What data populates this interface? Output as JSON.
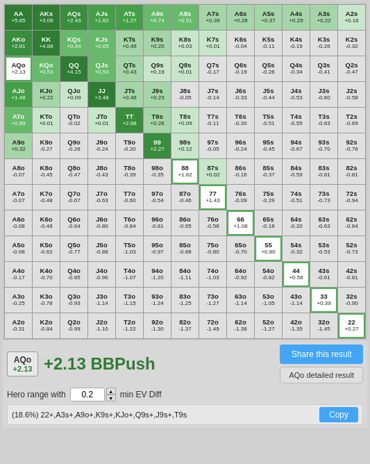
{
  "grid": {
    "cells": [
      {
        "hand": "AA",
        "ev": "+5.85",
        "type": "positive-high"
      },
      {
        "hand": "AKs",
        "ev": "+3.06",
        "type": "positive-high"
      },
      {
        "hand": "AQs",
        "ev": "+2.43",
        "type": "positive-high"
      },
      {
        "hand": "AJs",
        "ev": "+1.82",
        "type": "positive-mid"
      },
      {
        "hand": "ATs",
        "ev": "+1.27",
        "type": "positive-mid"
      },
      {
        "hand": "A9s",
        "ev": "+0.74",
        "type": "positive-low"
      },
      {
        "hand": "A8s",
        "ev": "+0.51",
        "type": "positive-low"
      },
      {
        "hand": "A7s",
        "ev": "+0.39",
        "type": "positive-low"
      },
      {
        "hand": "A6s",
        "ev": "+0.28",
        "type": "positive-low"
      },
      {
        "hand": "A5s",
        "ev": "+0.37",
        "type": "positive-low"
      },
      {
        "hand": "A4s",
        "ev": "+0.29",
        "type": "positive-low"
      },
      {
        "hand": "A3s",
        "ev": "+0.22",
        "type": "positive-low"
      },
      {
        "hand": "A2s",
        "ev": "+0.16",
        "type": "neutral"
      },
      {
        "hand": "AKo",
        "ev": "+2.81",
        "type": "positive-high"
      },
      {
        "hand": "KK",
        "ev": "+4.88",
        "type": "positive-high"
      },
      {
        "hand": "KQs",
        "ev": "+0.94",
        "type": "positive-low"
      },
      {
        "hand": "KJs",
        "ev": "+0.65",
        "type": "positive-low"
      },
      {
        "hand": "KTs",
        "ev": "+0.46",
        "type": "positive-low"
      },
      {
        "hand": "K9s",
        "ev": "+0.20",
        "type": "positive-low"
      },
      {
        "hand": "K8s",
        "ev": "+0.03",
        "type": "neutral"
      },
      {
        "hand": "K7s",
        "ev": "+0.01",
        "type": "neutral"
      },
      {
        "hand": "K6s",
        "ev": "-0.04",
        "type": "neutral"
      },
      {
        "hand": "K5s",
        "ev": "-0.11",
        "type": "neutral"
      },
      {
        "hand": "K4s",
        "ev": "-0.19",
        "type": "neutral"
      },
      {
        "hand": "K3s",
        "ev": "-0.26",
        "type": "neutral"
      },
      {
        "hand": "K2s",
        "ev": "-0.32",
        "type": "neutral"
      },
      {
        "hand": "AQo",
        "ev": "+2.13",
        "type": "positive-high",
        "selected": true
      },
      {
        "hand": "KQo",
        "ev": "+0.53",
        "type": "positive-low"
      },
      {
        "hand": "QQ",
        "ev": "+4.15",
        "type": "positive-high"
      },
      {
        "hand": "QJs",
        "ev": "+0.53",
        "type": "positive-low"
      },
      {
        "hand": "QTs",
        "ev": "+0.43",
        "type": "positive-low"
      },
      {
        "hand": "Q9s",
        "ev": "+0.19",
        "type": "positive-low"
      },
      {
        "hand": "Q8s",
        "ev": "+0.01",
        "type": "neutral"
      },
      {
        "hand": "Q7s",
        "ev": "-0.17",
        "type": "neutral"
      },
      {
        "hand": "Q6s",
        "ev": "-0.19",
        "type": "neutral"
      },
      {
        "hand": "Q5s",
        "ev": "-0.26",
        "type": "neutral"
      },
      {
        "hand": "Q4s",
        "ev": "-0.34",
        "type": "neutral"
      },
      {
        "hand": "Q3s",
        "ev": "-0.41",
        "type": "neutral"
      },
      {
        "hand": "Q2s",
        "ev": "-0.47",
        "type": "neutral"
      },
      {
        "hand": "AJo",
        "ev": "+1.48",
        "type": "positive-mid"
      },
      {
        "hand": "KJo",
        "ev": "+0.22",
        "type": "positive-low"
      },
      {
        "hand": "QJo",
        "ev": "+0.09",
        "type": "neutral"
      },
      {
        "hand": "JJ",
        "ev": "+3.48",
        "type": "positive-high"
      },
      {
        "hand": "JTs",
        "ev": "+0.46",
        "type": "positive-low"
      },
      {
        "hand": "J9s",
        "ev": "+0.23",
        "type": "positive-low"
      },
      {
        "hand": "J8s",
        "ev": "-0.05",
        "type": "neutral"
      },
      {
        "hand": "J7s",
        "ev": "-0.14",
        "type": "neutral"
      },
      {
        "hand": "J6s",
        "ev": "-0.33",
        "type": "neutral"
      },
      {
        "hand": "J5s",
        "ev": "-0.44",
        "type": "neutral"
      },
      {
        "hand": "J4s",
        "ev": "-0.53",
        "type": "neutral"
      },
      {
        "hand": "J3s",
        "ev": "-0.60",
        "type": "neutral"
      },
      {
        "hand": "J2s",
        "ev": "-0.58",
        "type": "neutral"
      },
      {
        "hand": "ATo",
        "ev": "+0.89",
        "type": "positive-low"
      },
      {
        "hand": "KTo",
        "ev": "+0.01",
        "type": "neutral"
      },
      {
        "hand": "QTo",
        "ev": "-0.02",
        "type": "neutral"
      },
      {
        "hand": "JTo",
        "ev": "+0.01",
        "type": "neutral"
      },
      {
        "hand": "TT",
        "ev": "+2.88",
        "type": "positive-high"
      },
      {
        "hand": "T9s",
        "ev": "+0.26",
        "type": "positive-low"
      },
      {
        "hand": "T8s",
        "ev": "+0.09",
        "type": "neutral"
      },
      {
        "hand": "T7s",
        "ev": "-0.11",
        "type": "neutral"
      },
      {
        "hand": "T6s",
        "ev": "-0.30",
        "type": "neutral"
      },
      {
        "hand": "T5s",
        "ev": "-0.51",
        "type": "neutral"
      },
      {
        "hand": "T4s",
        "ev": "-0.55",
        "type": "neutral"
      },
      {
        "hand": "T3s",
        "ev": "-0.63",
        "type": "neutral"
      },
      {
        "hand": "T2s",
        "ev": "-0.69",
        "type": "neutral"
      },
      {
        "hand": "A9o",
        "ev": "+0.32",
        "type": "positive-low"
      },
      {
        "hand": "K9o",
        "ev": "-0.27",
        "type": "neutral"
      },
      {
        "hand": "Q9o",
        "ev": "-0.28",
        "type": "neutral"
      },
      {
        "hand": "J9o",
        "ev": "-0.24",
        "type": "neutral"
      },
      {
        "hand": "T9o",
        "ev": "-0.20",
        "type": "neutral"
      },
      {
        "hand": "99",
        "ev": "+2.27",
        "type": "positive-high"
      },
      {
        "hand": "98s",
        "ev": "+0.12",
        "type": "neutral"
      },
      {
        "hand": "97s",
        "ev": "-0.05",
        "type": "neutral"
      },
      {
        "hand": "96s",
        "ev": "-0.24",
        "type": "neutral"
      },
      {
        "hand": "95s",
        "ev": "-0.45",
        "type": "neutral"
      },
      {
        "hand": "94s",
        "ev": "-0.67",
        "type": "neutral"
      },
      {
        "hand": "93s",
        "ev": "-0.70",
        "type": "neutral"
      },
      {
        "hand": "92s",
        "ev": "-0.76",
        "type": "neutral"
      },
      {
        "hand": "A8o",
        "ev": "-0.07",
        "type": "neutral"
      },
      {
        "hand": "K8o",
        "ev": "-0.45",
        "type": "neutral"
      },
      {
        "hand": "Q8o",
        "ev": "-0.47",
        "type": "neutral"
      },
      {
        "hand": "J8o",
        "ev": "-0.43",
        "type": "neutral"
      },
      {
        "hand": "T8o",
        "ev": "-0.39",
        "type": "neutral"
      },
      {
        "hand": "98o",
        "ev": "-0.35",
        "type": "neutral"
      },
      {
        "hand": "88",
        "ev": "+1.82",
        "type": "positive-mid",
        "selected": true
      },
      {
        "hand": "87s",
        "ev": "+0.02",
        "type": "neutral"
      },
      {
        "hand": "86s",
        "ev": "-0.16",
        "type": "neutral"
      },
      {
        "hand": "85s",
        "ev": "-0.37",
        "type": "neutral"
      },
      {
        "hand": "84s",
        "ev": "-0.59",
        "type": "neutral"
      },
      {
        "hand": "83s",
        "ev": "-0.81",
        "type": "neutral"
      },
      {
        "hand": "82s",
        "ev": "-0.81",
        "type": "neutral"
      },
      {
        "hand": "A7o",
        "ev": "-0.07",
        "type": "neutral"
      },
      {
        "hand": "K7o",
        "ev": "-0.48",
        "type": "neutral"
      },
      {
        "hand": "Q7o",
        "ev": "-0.67",
        "type": "neutral"
      },
      {
        "hand": "J7o",
        "ev": "-0.63",
        "type": "neutral"
      },
      {
        "hand": "T7o",
        "ev": "-0.60",
        "type": "neutral"
      },
      {
        "hand": "97o",
        "ev": "-0.54",
        "type": "neutral"
      },
      {
        "hand": "87o",
        "ev": "-0.46",
        "type": "neutral"
      },
      {
        "hand": "77",
        "ev": "+1.43",
        "type": "positive-mid",
        "selected": true
      },
      {
        "hand": "76s",
        "ev": "-0.09",
        "type": "neutral"
      },
      {
        "hand": "75s",
        "ev": "-0.29",
        "type": "neutral"
      },
      {
        "hand": "74s",
        "ev": "-0.51",
        "type": "neutral"
      },
      {
        "hand": "73s",
        "ev": "-0.73",
        "type": "neutral"
      },
      {
        "hand": "72s",
        "ev": "-0.94",
        "type": "neutral"
      },
      {
        "hand": "A6o",
        "ev": "-0.08",
        "type": "neutral"
      },
      {
        "hand": "K6o",
        "ev": "-0.48",
        "type": "neutral"
      },
      {
        "hand": "Q6o",
        "ev": "-0.64",
        "type": "neutral"
      },
      {
        "hand": "J6o",
        "ev": "-0.80",
        "type": "neutral"
      },
      {
        "hand": "T6o",
        "ev": "-0.84",
        "type": "neutral"
      },
      {
        "hand": "96o",
        "ev": "-0.81",
        "type": "neutral"
      },
      {
        "hand": "86o",
        "ev": "-0.65",
        "type": "neutral"
      },
      {
        "hand": "76o",
        "ev": "-0.58",
        "type": "neutral"
      },
      {
        "hand": "66",
        "ev": "+1.08",
        "type": "positive-mid",
        "selected": true
      },
      {
        "hand": "65s",
        "ev": "-0.18",
        "type": "neutral"
      },
      {
        "hand": "64s",
        "ev": "-0.20",
        "type": "neutral"
      },
      {
        "hand": "63s",
        "ev": "-0.63",
        "type": "neutral"
      },
      {
        "hand": "62s",
        "ev": "-0.84",
        "type": "neutral"
      },
      {
        "hand": "A5o",
        "ev": "-0.08",
        "type": "neutral"
      },
      {
        "hand": "K5o",
        "ev": "-0.62",
        "type": "neutral"
      },
      {
        "hand": "Q5o",
        "ev": "-0.77",
        "type": "neutral"
      },
      {
        "hand": "J5o",
        "ev": "-0.88",
        "type": "neutral"
      },
      {
        "hand": "T5o",
        "ev": "-1.03",
        "type": "neutral"
      },
      {
        "hand": "95o",
        "ev": "-0.97",
        "type": "neutral"
      },
      {
        "hand": "85o",
        "ev": "-0.88",
        "type": "neutral"
      },
      {
        "hand": "75o",
        "ev": "-0.80",
        "type": "neutral"
      },
      {
        "hand": "65o",
        "ev": "-0.70",
        "type": "neutral"
      },
      {
        "hand": "55",
        "ev": "+0.80",
        "type": "positive-low",
        "selected": true
      },
      {
        "hand": "54s",
        "ev": "-0.32",
        "type": "neutral"
      },
      {
        "hand": "53s",
        "ev": "-0.53",
        "type": "neutral"
      },
      {
        "hand": "52s",
        "ev": "-0.73",
        "type": "neutral"
      },
      {
        "hand": "A4o",
        "ev": "-0.17",
        "type": "neutral"
      },
      {
        "hand": "K4o",
        "ev": "-0.70",
        "type": "neutral"
      },
      {
        "hand": "Q4o",
        "ev": "-0.85",
        "type": "neutral"
      },
      {
        "hand": "J4o",
        "ev": "-0.96",
        "type": "neutral"
      },
      {
        "hand": "T4o",
        "ev": "-1.07",
        "type": "neutral"
      },
      {
        "hand": "94o",
        "ev": "-1.20",
        "type": "neutral"
      },
      {
        "hand": "84o",
        "ev": "-1.11",
        "type": "neutral"
      },
      {
        "hand": "74o",
        "ev": "-1.03",
        "type": "neutral"
      },
      {
        "hand": "64o",
        "ev": "-0.92",
        "type": "neutral"
      },
      {
        "hand": "54o",
        "ev": "-0.82",
        "type": "neutral"
      },
      {
        "hand": "44",
        "ev": "+0.58",
        "type": "positive-low",
        "selected": true
      },
      {
        "hand": "43s",
        "ev": "-0.61",
        "type": "neutral"
      },
      {
        "hand": "42s",
        "ev": "-0.81",
        "type": "neutral"
      },
      {
        "hand": "A3o",
        "ev": "-0.25",
        "type": "neutral"
      },
      {
        "hand": "K3o",
        "ev": "-0.78",
        "type": "neutral"
      },
      {
        "hand": "Q3o",
        "ev": "-0.93",
        "type": "neutral"
      },
      {
        "hand": "J3o",
        "ev": "-1.14",
        "type": "neutral"
      },
      {
        "hand": "T3o",
        "ev": "-1.15",
        "type": "neutral"
      },
      {
        "hand": "93o",
        "ev": "-1.24",
        "type": "neutral"
      },
      {
        "hand": "83o",
        "ev": "-1.25",
        "type": "neutral"
      },
      {
        "hand": "73o",
        "ev": "-1.27",
        "type": "neutral"
      },
      {
        "hand": "63o",
        "ev": "-1.14",
        "type": "neutral"
      },
      {
        "hand": "53o",
        "ev": "-1.05",
        "type": "neutral"
      },
      {
        "hand": "43o",
        "ev": "-1.14",
        "type": "neutral"
      },
      {
        "hand": "33",
        "ev": "+0.39",
        "type": "positive-low",
        "selected": true
      },
      {
        "hand": "32s",
        "ev": "-0.90",
        "type": "neutral"
      },
      {
        "hand": "A2o",
        "ev": "-0.31",
        "type": "neutral"
      },
      {
        "hand": "K2o",
        "ev": "-0.84",
        "type": "neutral"
      },
      {
        "hand": "Q2o",
        "ev": "-0.99",
        "type": "neutral"
      },
      {
        "hand": "J2o",
        "ev": "-1.10",
        "type": "neutral"
      },
      {
        "hand": "T2o",
        "ev": "-1.22",
        "type": "neutral"
      },
      {
        "hand": "92o",
        "ev": "-1.30",
        "type": "neutral"
      },
      {
        "hand": "82o",
        "ev": "-1.37",
        "type": "neutral"
      },
      {
        "hand": "72o",
        "ev": "-1.49",
        "type": "neutral"
      },
      {
        "hand": "62o",
        "ev": "-1.38",
        "type": "neutral"
      },
      {
        "hand": "52o",
        "ev": "-1.27",
        "type": "neutral"
      },
      {
        "hand": "42o",
        "ev": "-1.35",
        "type": "neutral"
      },
      {
        "hand": "32o",
        "ev": "-1.45",
        "type": "neutral"
      },
      {
        "hand": "22",
        "ev": "+0.27",
        "type": "positive-low",
        "selected": true
      }
    ]
  },
  "result": {
    "hand": "AQo",
    "ev_badge": "+2.13",
    "ev_text": "+2.13 BBPush",
    "share_button": "Share this result",
    "detail_button": "AQo detailed result"
  },
  "range": {
    "label": "Hero range with",
    "value": "0.2",
    "suffix": "min EV Diff"
  },
  "output": {
    "text": "(18.6%) 22+,A3s+,A9o+,K9s+,KJo+,Q9s+,J9s+,T9s",
    "copy_label": "Copy"
  }
}
